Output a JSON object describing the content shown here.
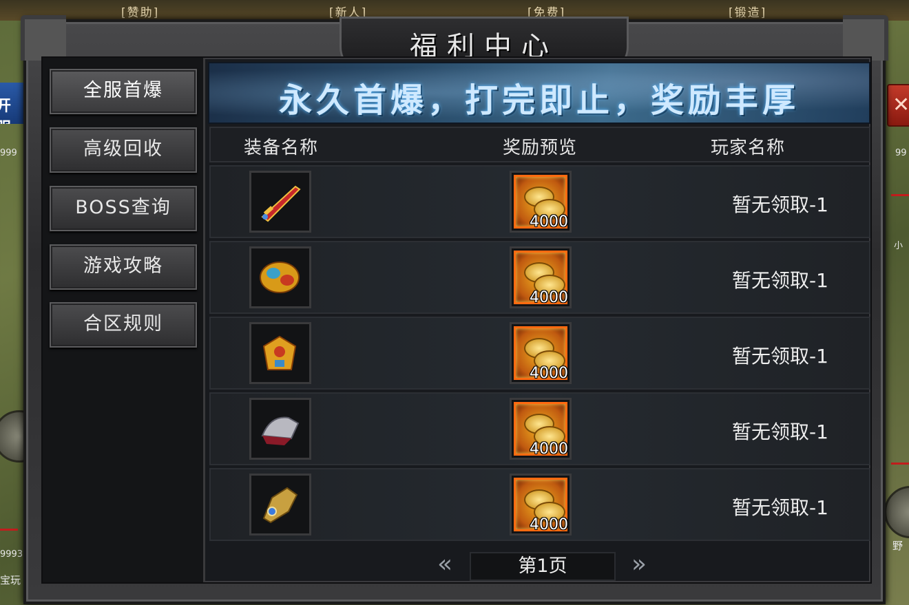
{
  "background": {
    "top_buttons": [
      "[赞助]",
      "[新人]",
      "[免费]",
      "[锻造]"
    ],
    "left_tag": "开服",
    "numbers_left": [
      "999",
      "9993"
    ],
    "left_bottom_text": "宝玩",
    "right_numbers": [
      "99"
    ],
    "right_texts": [
      "小",
      "野"
    ]
  },
  "window": {
    "title": "福利中心",
    "banner": "永久首爆，打完即止，奖励丰厚"
  },
  "sidebar": {
    "items": [
      {
        "label": "全服首爆"
      },
      {
        "label": "高级回收"
      },
      {
        "label": "BOSS查询"
      },
      {
        "label": "游戏攻略"
      },
      {
        "label": "合区规则"
      }
    ]
  },
  "table": {
    "headers": [
      "装备名称",
      "奖励预览",
      "玩家名称"
    ],
    "rows": [
      {
        "item_icon": "sword-icon",
        "reward_count": "4000",
        "player": "暂无领取-1"
      },
      {
        "item_icon": "armor-icon",
        "reward_count": "4000",
        "player": "暂无领取-1"
      },
      {
        "item_icon": "robe-icon",
        "reward_count": "4000",
        "player": "暂无领取-1"
      },
      {
        "item_icon": "helmet-icon",
        "reward_count": "4000",
        "player": "暂无领取-1"
      },
      {
        "item_icon": "gauntlet-icon",
        "reward_count": "4000",
        "player": "暂无领取-1"
      }
    ]
  },
  "pager": {
    "prev_icon": "double-chevron-left-icon",
    "next_icon": "double-chevron-right-icon",
    "page": "第1页"
  },
  "close_icon": "close-icon"
}
